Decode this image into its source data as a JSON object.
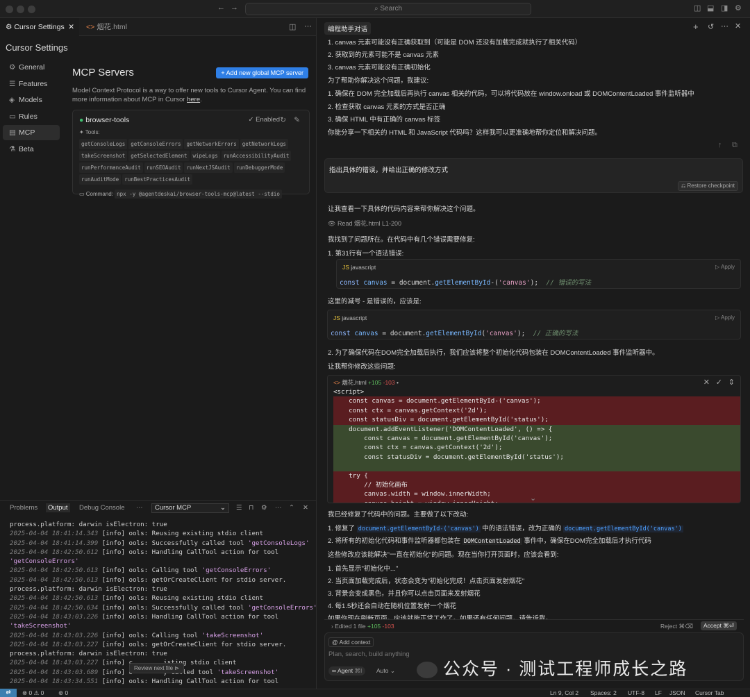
{
  "titlebar": {
    "search_placeholder": "Search"
  },
  "tabs": {
    "active": "Cursor Settings",
    "file": "烟花.html"
  },
  "settings": {
    "title": "Cursor Settings",
    "nav": [
      {
        "label": "General",
        "icon": "gear-icon"
      },
      {
        "label": "Features",
        "icon": "sliders-icon"
      },
      {
        "label": "Models",
        "icon": "cube-icon"
      },
      {
        "label": "Rules",
        "icon": "file-icon"
      },
      {
        "label": "MCP",
        "icon": "server-icon"
      },
      {
        "label": "Beta",
        "icon": "flask-icon"
      }
    ]
  },
  "mcp": {
    "heading": "MCP Servers",
    "add_button": "+ Add new global MCP server",
    "desc": "Model Context Protocol is a way to offer new tools to Cursor Agent. You can find more information about MCP in Cursor ",
    "desc_link": "here",
    "desc_end": ".",
    "server": {
      "name": "browser-tools",
      "status": "Enabled",
      "tools_label": "Tools:",
      "tools": [
        "getConsoleLogs",
        "getConsoleErrors",
        "getNetworkErrors",
        "getNetworkLogs",
        "takeScreenshot",
        "getSelectedElement",
        "wipeLogs",
        "runAccessibilityAudit",
        "runPerformanceAudit",
        "runSEOAudit",
        "runNextJSAudit",
        "runDebuggerMode",
        "runAuditMode",
        "runBestPracticesAudit"
      ],
      "command_label": "Command:",
      "command": "npx -y @agentdeskai/browser-tools-mcp@latest --stdio"
    }
  },
  "panel": {
    "tabs": [
      "Problems",
      "Output",
      "Debug Console"
    ],
    "channel": "Cursor MCP",
    "review": "Review next file",
    "log": [
      {
        "ts": "",
        "text": "process.platform: darwin isElectron: true"
      },
      {
        "ts": "2025-04-04 18:41:14.343",
        "text": " [info] ools: Reusing existing stdio client"
      },
      {
        "ts": "2025-04-04 18:41:14.399",
        "text": " [info] ools: Successfully called tool ",
        "str": "'getConsoleLogs'"
      },
      {
        "ts": "2025-04-04 18:42:50.612",
        "text": " [info] ools: Handling CallTool action for tool"
      },
      {
        "ts": "",
        "text": "",
        "str": "'getConsoleErrors'"
      },
      {
        "ts": "2025-04-04 18:42:50.613",
        "text": " [info] ools: Calling tool ",
        "str": "'getConsoleErrors'"
      },
      {
        "ts": "2025-04-04 18:42:50.613",
        "text": " [info] ools: getOrCreateClient for stdio server."
      },
      {
        "ts": "",
        "text": "process.platform: darwin isElectron: true"
      },
      {
        "ts": "2025-04-04 18:42:50.613",
        "text": " [info] ools: Reusing existing stdio client"
      },
      {
        "ts": "2025-04-04 18:42:50.634",
        "text": " [info] ools: Successfully called tool ",
        "str": "'getConsoleErrors'"
      },
      {
        "ts": "2025-04-04 18:43:03.226",
        "text": " [info] ools: Handling CallTool action for tool"
      },
      {
        "ts": "",
        "text": "",
        "str": "'takeScreenshot'"
      },
      {
        "ts": "2025-04-04 18:43:03.226",
        "text": " [info] ools: Calling tool ",
        "str": "'takeScreenshot'"
      },
      {
        "ts": "2025-04-04 18:43:03.227",
        "text": " [info] ools: getOrCreateClient for stdio server."
      },
      {
        "ts": "",
        "text": "process.platform: darwin isElectron: true"
      },
      {
        "ts": "2025-04-04 18:43:03.227",
        "text": " [info] c        isting stdio client"
      },
      {
        "ts": "2025-04-04 18:43:03.689",
        "text": " [info] o        y called tool ",
        "str": "'takeScreenshot'"
      },
      {
        "ts": "2025-04-04 18:43:34.551",
        "text": " [info] ools: Handling CallTool action for tool"
      }
    ]
  },
  "status": {
    "errors": "0",
    "warnings": "0",
    "ports": "0",
    "position": "Ln 9, Col 2",
    "spaces": "Spaces: 2",
    "encoding": "UTF-8",
    "eol": "LF",
    "lang": "JSON",
    "tab": "Cursor Tab"
  },
  "chat": {
    "title": "编程助手对话",
    "lines_top": [
      "1. canvas 元素可能没有正确获取到（可能是 DOM 还没有加载完成就执行了相关代码）",
      "2. 获取到的元素可能不是 canvas 元素",
      "3. canvas 元素可能没有正确初始化",
      "为了帮助你解决这个问题，我建议:",
      "1. 确保在 DOM 完全加载后再执行 canvas 相关的代码，可以将代码放在 window.onload 或 DOMContentLoaded 事件监听器中",
      "2. 检查获取 canvas 元素的方式是否正确",
      "3. 确保 HTML 中有正确的 canvas 标签",
      "你能分享一下相关的 HTML 和 JavaScript 代码吗？这样我可以更准确地帮你定位和解决问题。"
    ],
    "user_msg": "指出具体的错误，并给出正确的修改方式",
    "restore": "Restore checkpoint",
    "check": "让我查看一下具体的代码内容来帮你解决这个问题。",
    "read": "Read 烟花.html L1-200",
    "found": "我找到了问题所在。在代码中有几个错误需要修复:",
    "err1": "1. 第31行有一个语法错误:",
    "lang": "javascript",
    "apply": "Apply",
    "code_wrong": {
      "pre": "const ",
      "var": "canvas",
      "mid": " = document.",
      "fn": "getElementById",
      "post": "-(",
      "s": "'canvas'",
      "end": ");  ",
      "cm": "// 错误的写法"
    },
    "minus_note": "这里的减号 - 是错误的，应该是:",
    "code_right": {
      "pre": "const ",
      "var": "canvas",
      "mid": " = document.",
      "fn": "getElementById",
      "post": "(",
      "s": "'canvas'",
      "end": ");  ",
      "cm": "// 正确的写法"
    },
    "err2": "2. 为了确保代码在DOM完全加载后执行，我们应该将整个初始化代码包装在 DOMContentLoaded 事件监听器中。",
    "fix_intro": "让我帮你修改这些问题:",
    "diff_file": "烟花.html",
    "diff_add": "+105",
    "diff_del": "-103",
    "diff_lines": [
      {
        "t": "<script>",
        "k": "ctx"
      },
      {
        "t": "    const canvas = document.getElementById-('canvas');",
        "k": "red"
      },
      {
        "t": "    const ctx = canvas.getContext('2d');",
        "k": "red"
      },
      {
        "t": "    const statusDiv = document.getElementById('status');",
        "k": "red"
      },
      {
        "t": "    document.addEventListener('DOMContentLoaded', () => {",
        "k": "grn"
      },
      {
        "t": "        const canvas = document.getElementById('canvas');",
        "k": "grn"
      },
      {
        "t": "        const ctx = canvas.getContext('2d');",
        "k": "grn"
      },
      {
        "t": "        const statusDiv = document.getElementById('status');",
        "k": "grn"
      },
      {
        "t": "",
        "k": "grn"
      },
      {
        "t": "    try {",
        "k": "red"
      },
      {
        "t": "        // 初始化画布",
        "k": "red"
      },
      {
        "t": "        canvas.width = window.innerWidth;",
        "k": "red"
      },
      {
        "t": "        canvas.height = window.innerHeight;",
        "k": "red"
      }
    ],
    "fixed": "我已经修复了代码中的问题。主要做了以下改动:",
    "fix1_pre": "1. 修复了 ",
    "fix1_code1": "document.getElementById-('canvas')",
    "fix1_mid": " 中的语法错误，改为正确的 ",
    "fix1_code2": "document.getElementById('canvas')",
    "fix2_pre": "2. 将所有的初始化代码和事件监听器都包装在 ",
    "fix2_code": "DOMContentLoaded",
    "fix2_post": " 事件中，确保在DOM完全加载后才执行代码",
    "solve": "这些修改应该能解决\"一直在初始化\"的问题。现在当你打开页面时，应该会看到:",
    "see": [
      "1. 首先显示\"初始化中...\"",
      "2. 当页面加载完成后，状态会变为\"初始化完成！点击页面发射烟花\"",
      "3. 背景会变成黑色，并且你可以点击页面来发射烟花",
      "4. 每1.5秒还会自动在随机位置发射一个烟花"
    ],
    "last": "如果你现在刷新页面，应该就能正常工作了。如果还有任何问题，请告诉我。",
    "edited": "Edited 1 file",
    "edited_add": "+105",
    "edited_del": "-103",
    "reject": "Reject ⌘⌫",
    "accept": "Accept ⌘⏎",
    "add_context": "Add context",
    "placeholder": "Plan, search, build anything",
    "agent": "Agent",
    "agent_key": "⌘I",
    "auto": "Auto"
  },
  "watermark": "公众号 · 测试工程师成长之路"
}
